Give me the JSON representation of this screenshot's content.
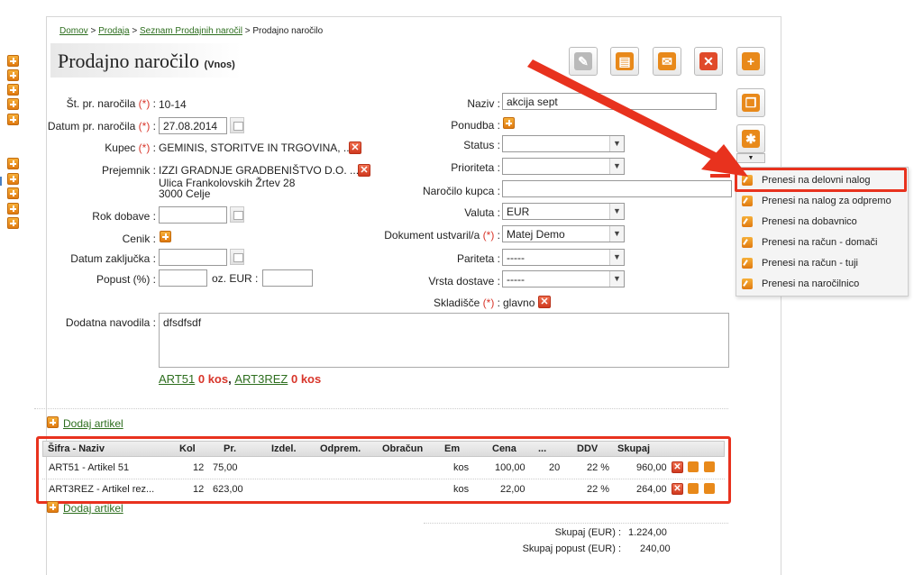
{
  "breadcrumb": {
    "items": [
      "Domov",
      "Prodaja",
      "Seznam Prodajnih naročil"
    ],
    "current": "Prodajno naročilo",
    "separator": ">"
  },
  "page": {
    "title": "Prodajno naročilo",
    "mode": "(Vnos)"
  },
  "form_left": {
    "order_no_label": "Št. pr. naročila",
    "order_no_value": "10-14",
    "order_date_label": "Datum pr. naročila",
    "order_date_value": "27.08.2014",
    "customer_label": "Kupec",
    "customer_value": "GEMINIS, STORITVE IN TRGOVINA, ...",
    "recipient_label": "Prejemnik",
    "recipient_name": "IZZI GRADNJE GRADBENIŠTVO D.O. ...",
    "recipient_street": "Ulica Frankolovskih Žrtev 28",
    "recipient_city": "3000 Celje",
    "delivery_label": "Rok dobave",
    "pricelist_label": "Cenik",
    "close_date_label": "Datum zaključka",
    "discount_label": "Popust (%)",
    "discount_or_label": "oz. EUR"
  },
  "form_right": {
    "name_label": "Naziv",
    "name_value": "akcija sept",
    "offer_label": "Ponudba",
    "status_label": "Status",
    "priority_label": "Prioriteta",
    "customer_order_label": "Naročilo kupca",
    "currency_label": "Valuta",
    "currency_value": "EUR",
    "created_by_label": "Dokument ustvaril/a",
    "created_by_value": "Matej Demo",
    "parity_label": "Pariteta",
    "parity_value": "-----",
    "delivery_type_label": "Vrsta dostave",
    "delivery_type_value": "-----",
    "warehouse_label": "Skladišče",
    "warehouse_value": "glavno"
  },
  "required_marker": "(*)",
  "notes": {
    "label": "Dodatna navodila",
    "value": "dfsdfsdf"
  },
  "stock_info": {
    "item1_code": "ART51",
    "item1_qty": "0 kos",
    "sep": ",",
    "item2_code": "ART3REZ",
    "item2_qty": "0 kos"
  },
  "add_item_label": "Dodaj artikel",
  "table": {
    "headers": [
      "Šifra - Naziv",
      "Kol",
      "Pr.",
      "Izdel.",
      "Odprem.",
      "Obračun",
      "Em",
      "Cena",
      "...",
      "DDV",
      "Skupaj"
    ],
    "rows": [
      {
        "name": "ART51 - Artikel 51",
        "kol": "12",
        "pr": "75,00",
        "em": "kos",
        "cena": "100,00",
        "extra": "20",
        "ddv": "22 %",
        "skupaj": "960,00"
      },
      {
        "name": "ART3REZ - Artikel rez...",
        "kol": "12",
        "pr": "623,00",
        "em": "kos",
        "cena": "22,00",
        "extra": "",
        "ddv": "22 %",
        "skupaj": "264,00"
      }
    ]
  },
  "totals": {
    "total_label": "Skupaj (EUR) :",
    "total_value": "1.224,00",
    "discount_label": "Skupaj popust (EUR) :",
    "discount_value": "240,00"
  },
  "dropdown_menu": {
    "items": [
      "Prenesi na delovni nalog",
      "Prenesi na nalog za odpremo",
      "Prenesi na dobavnico",
      "Prenesi na račun - domači",
      "Prenesi na račun - tuji",
      "Prenesi na naročilnico"
    ]
  },
  "colors": {
    "annotation_red": "#e8321e",
    "orange": "#e8891a",
    "link_green": "#2d6e1e",
    "stock_red": "#d8352a"
  },
  "icons": {
    "toolbar": [
      "edit-icon",
      "print-icon",
      "email-icon",
      "delete-icon",
      "add-icon",
      "copy-icon",
      "settings-icon"
    ]
  }
}
